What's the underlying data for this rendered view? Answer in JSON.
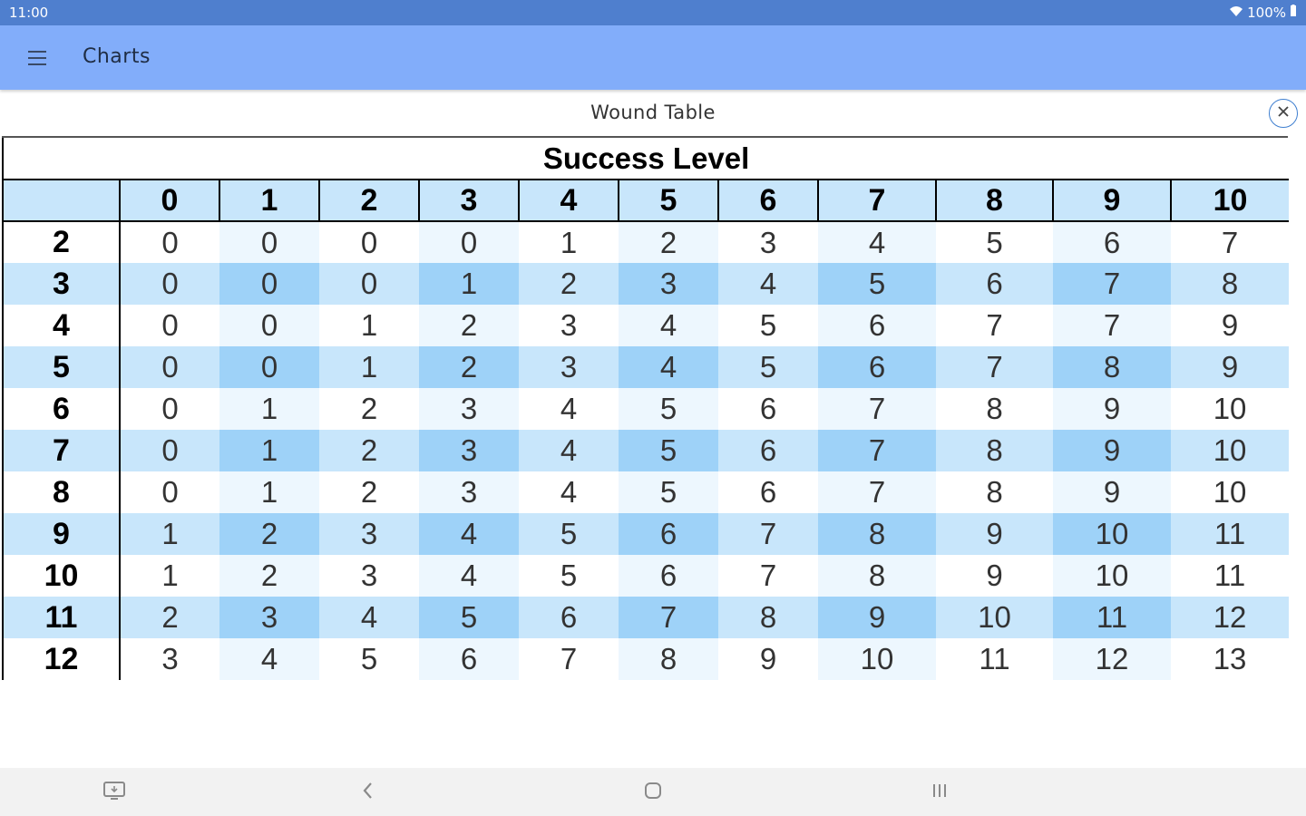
{
  "status_bar": {
    "time": "11:00",
    "battery": "100%"
  },
  "app_bar": {
    "title": "Charts"
  },
  "dialog": {
    "title": "Wound Table"
  },
  "table": {
    "super_header": "Success Level",
    "columns": [
      "0",
      "1",
      "2",
      "3",
      "4",
      "5",
      "6",
      "7",
      "8",
      "9",
      "10"
    ],
    "rows": [
      {
        "label": "2",
        "values": [
          "0",
          "0",
          "0",
          "0",
          "1",
          "2",
          "3",
          "4",
          "5",
          "6",
          "7"
        ]
      },
      {
        "label": "3",
        "values": [
          "0",
          "0",
          "0",
          "1",
          "2",
          "3",
          "4",
          "5",
          "6",
          "7",
          "8"
        ]
      },
      {
        "label": "4",
        "values": [
          "0",
          "0",
          "1",
          "2",
          "3",
          "4",
          "5",
          "6",
          "7",
          "7",
          "9"
        ]
      },
      {
        "label": "5",
        "values": [
          "0",
          "0",
          "1",
          "2",
          "3",
          "4",
          "5",
          "6",
          "7",
          "8",
          "9"
        ]
      },
      {
        "label": "6",
        "values": [
          "0",
          "1",
          "2",
          "3",
          "4",
          "5",
          "6",
          "7",
          "8",
          "9",
          "10"
        ]
      },
      {
        "label": "7",
        "values": [
          "0",
          "1",
          "2",
          "3",
          "4",
          "5",
          "6",
          "7",
          "8",
          "9",
          "10"
        ]
      },
      {
        "label": "8",
        "values": [
          "0",
          "1",
          "2",
          "3",
          "4",
          "5",
          "6",
          "7",
          "8",
          "9",
          "10"
        ]
      },
      {
        "label": "9",
        "values": [
          "1",
          "2",
          "3",
          "4",
          "5",
          "6",
          "7",
          "8",
          "9",
          "10",
          "11"
        ]
      },
      {
        "label": "10",
        "values": [
          "1",
          "2",
          "3",
          "4",
          "5",
          "6",
          "7",
          "8",
          "9",
          "10",
          "11"
        ]
      },
      {
        "label": "11",
        "values": [
          "2",
          "3",
          "4",
          "5",
          "6",
          "7",
          "8",
          "9",
          "10",
          "11",
          "12"
        ]
      },
      {
        "label": "12",
        "values": [
          "3",
          "4",
          "5",
          "6",
          "7",
          "8",
          "9",
          "10",
          "11",
          "12",
          "13"
        ]
      }
    ]
  },
  "colors": {
    "status_bar": "#4f7fce",
    "app_bar": "#82adfa",
    "header_row": "#c8e6fb",
    "even_row_light": "#edf7fe",
    "even_row_dark": "#ddf0fd",
    "odd_row_light": "#c8e6fb",
    "odd_row_dark": "#9ed2f8"
  },
  "nav_bar": {
    "icons": [
      "screenshot-icon",
      "back-icon",
      "home-icon",
      "recents-icon"
    ]
  }
}
